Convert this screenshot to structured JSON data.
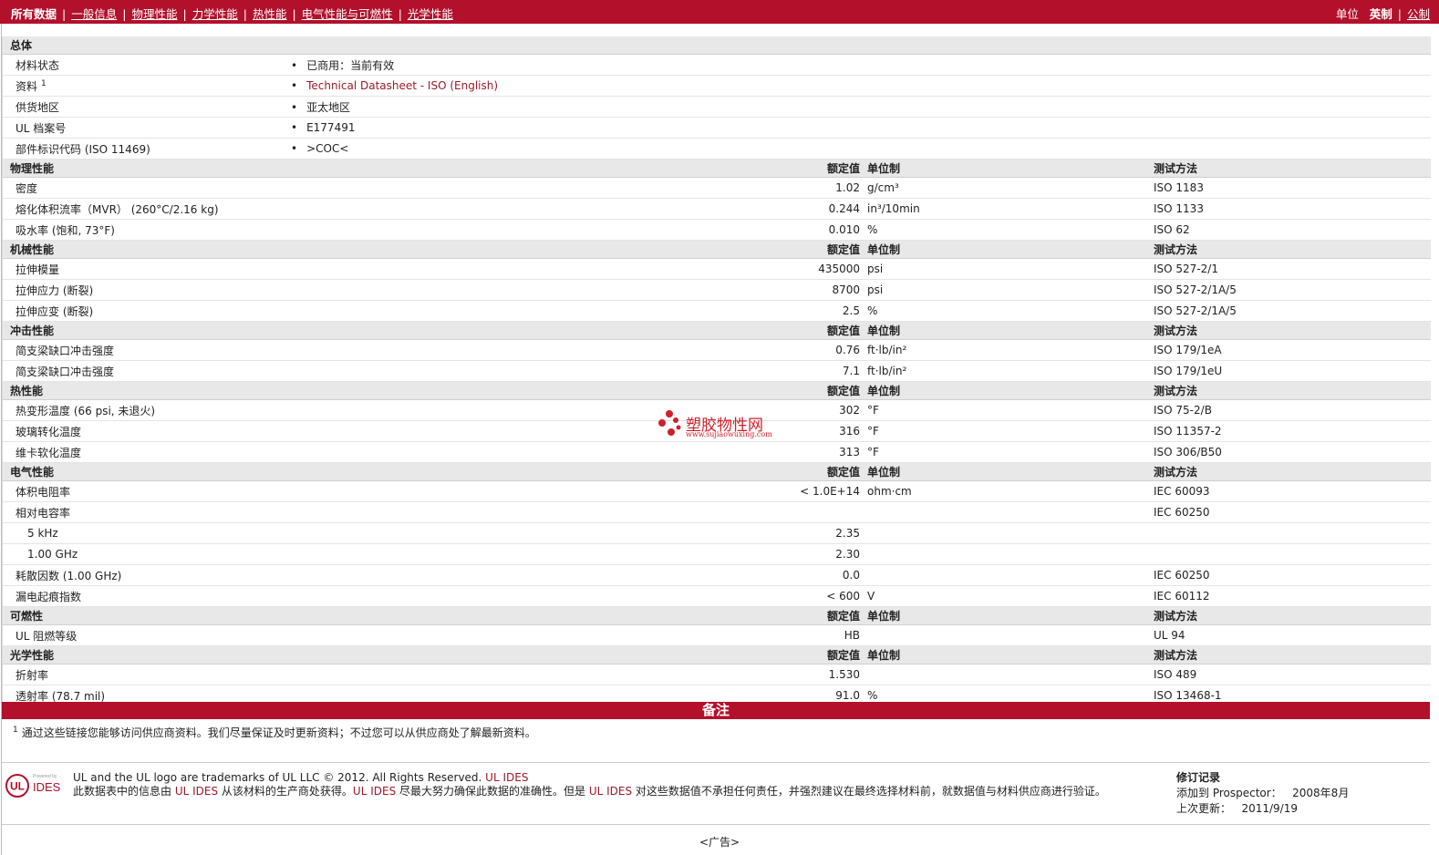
{
  "nav": {
    "tabs": [
      {
        "label": "所有数据",
        "active": true
      },
      {
        "label": "一般信息",
        "active": false
      },
      {
        "label": "物理性能",
        "active": false
      },
      {
        "label": "力学性能",
        "active": false
      },
      {
        "label": "热性能",
        "active": false
      },
      {
        "label": "电气性能与可燃性",
        "active": false
      },
      {
        "label": "光学性能",
        "active": false
      }
    ],
    "units_label": "单位",
    "unit_imperial": "英制",
    "unit_metric": "公制"
  },
  "general": {
    "title": "总体",
    "rows": [
      {
        "label": "材料状态",
        "value": "已商用：当前有效"
      },
      {
        "label": "资料",
        "sup": "1",
        "value": "Technical Datasheet - ISO (English)"
      },
      {
        "label": "供货地区",
        "value": "亚太地区"
      },
      {
        "label": "UL 档案号",
        "value": "E177491"
      },
      {
        "label": "部件标识代码  (ISO 11469)",
        "value": ">COC<"
      }
    ]
  },
  "headers": {
    "value": "额定值",
    "unit": "单位制",
    "method": "测试方法"
  },
  "sections": [
    {
      "title": "物理性能",
      "rows": [
        {
          "label": "密度",
          "value": "1.02",
          "unit": "g/cm³",
          "method": "ISO 1183"
        },
        {
          "label": "熔化体积流率（MVR）   (260°C/2.16 kg)",
          "value": "0.244",
          "unit": "in³/10min",
          "method": "ISO 1133"
        },
        {
          "label": "吸水率  (饱和, 73°F)",
          "value": "0.010",
          "unit": "%",
          "method": "ISO 62"
        }
      ]
    },
    {
      "title": "机械性能",
      "rows": [
        {
          "label": "拉伸模量",
          "value": "435000",
          "unit": "psi",
          "method": "ISO 527-2/1"
        },
        {
          "label": "拉伸应力  (断裂)",
          "value": "8700",
          "unit": "psi",
          "method": "ISO 527-2/1A/5"
        },
        {
          "label": "拉伸应变  (断裂)",
          "value": "2.5",
          "unit": "%",
          "method": "ISO 527-2/1A/5"
        }
      ]
    },
    {
      "title": "冲击性能",
      "rows": [
        {
          "label": "简支梁缺口冲击强度",
          "value": "0.76",
          "unit": "ft·lb/in²",
          "method": "ISO 179/1eA"
        },
        {
          "label": "简支梁缺口冲击强度",
          "value": "7.1",
          "unit": "ft·lb/in²",
          "method": "ISO 179/1eU"
        }
      ]
    },
    {
      "title": "热性能",
      "rows": [
        {
          "label": "热变形温度  (66 psi, 未退火)",
          "value": "302",
          "unit": "°F",
          "method": "ISO 75-2/B"
        },
        {
          "label": "玻璃转化温度",
          "value": "316",
          "unit": "°F",
          "method": "ISO 11357-2"
        },
        {
          "label": "维卡软化温度",
          "value": "313",
          "unit": "°F",
          "method": "ISO 306/B50"
        }
      ]
    },
    {
      "title": "电气性能",
      "rows": [
        {
          "label": "体积电阻率",
          "value": "< 1.0E+14",
          "unit": "ohm·cm",
          "method": "IEC 60093"
        },
        {
          "label": "相对电容率",
          "value": "",
          "unit": "",
          "method": "IEC 60250"
        },
        {
          "label": "5 kHz",
          "value": "2.35",
          "unit": "",
          "method": "",
          "sub": true
        },
        {
          "label": "1.00 GHz",
          "value": "2.30",
          "unit": "",
          "method": "",
          "sub": true
        },
        {
          "label": "耗散因数  (1.00 GHz)",
          "value": "0.0",
          "unit": "",
          "method": "IEC 60250"
        },
        {
          "label": "漏电起痕指数",
          "value": "< 600",
          "unit": "V",
          "method": "IEC 60112"
        }
      ]
    },
    {
      "title": "可燃性",
      "rows": [
        {
          "label": "UL 阻燃等级",
          "value": "HB",
          "unit": "",
          "method": "UL 94"
        }
      ]
    },
    {
      "title": "光学性能",
      "rows": [
        {
          "label": "折射率",
          "value": "1.530",
          "unit": "",
          "method": "ISO 489"
        },
        {
          "label": "透射率  (78.7 mil)",
          "value": "91.0",
          "unit": "%",
          "method": "ISO 13468-1"
        }
      ]
    }
  ],
  "notes": {
    "title": "备注",
    "sup": "1",
    "text": "通过这些链接您能够访问供应商资料。我们尽量保证及时更新资料；不过您可以从供应商处了解最新资料。"
  },
  "footer": {
    "logo_powered": "Powered by",
    "logo_ul": "UL",
    "logo_ides": "IDES",
    "line1": "UL and the UL logo are trademarks of UL LLC © 2012. All Rights Reserved. ",
    "line1_link": "UL IDES",
    "line2_a": "此数据表中的信息由 ",
    "line2_link1": "UL IDES",
    "line2_b": " 从该材料的生产商处获得。",
    "line2_link2": "UL IDES",
    "line2_c": " 尽最大努力确保此数据的准确性。但是 ",
    "line2_link3": "UL IDES",
    "line2_d": " 对这些数据值不承担任何责任，并强烈建议在最终选择材料前，就数据值与材料供应商进行验证。",
    "rev_title": "修订记录",
    "rev_added_label": "添加到 Prospector：",
    "rev_added_value": "2008年8月",
    "rev_updated_label": "上次更新：",
    "rev_updated_value": "2011/9/19"
  },
  "watermark": {
    "name": "塑胶物性网",
    "url": "www.sujiaowuxing.com"
  },
  "ad": "<广告>"
}
